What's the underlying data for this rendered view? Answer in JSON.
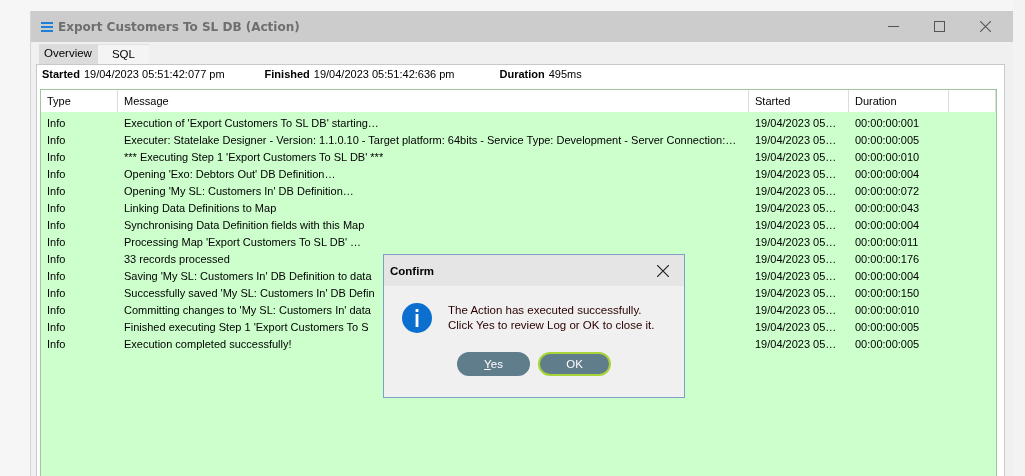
{
  "window": {
    "title": "Export Customers To SL DB (Action)"
  },
  "tabs": [
    {
      "label": "Overview",
      "selected": true
    },
    {
      "label": "SQL",
      "selected": false
    }
  ],
  "summary": [
    {
      "label": "Started",
      "value": "19/04/2023 05:51:42:077 pm"
    },
    {
      "label": "Finished",
      "value": "19/04/2023 05:51:42:636 pm"
    },
    {
      "label": "Duration",
      "value": "495ms"
    }
  ],
  "table": {
    "columns": [
      "Type",
      "Message",
      "Started",
      "Duration"
    ],
    "rows": [
      {
        "type": "Info",
        "message": "Execution of 'Export Customers To SL DB' starting…",
        "started": "19/04/2023 05…",
        "duration": "00:00:00:001"
      },
      {
        "type": "Info",
        "message": "Executer: Statelake Designer - Version: 1.1.0.10 - Target platform:  64bits - Service Type: Development - Server Connection:…",
        "started": "19/04/2023 05…",
        "duration": "00:00:00:005"
      },
      {
        "type": "Info",
        "message": "*** Executing Step 1 'Export Customers To SL DB' ***",
        "started": "19/04/2023 05…",
        "duration": "00:00:00:010"
      },
      {
        "type": "Info",
        "message": "Opening 'Exo: Debtors Out' DB Definition…",
        "started": "19/04/2023 05…",
        "duration": "00:00:00:004"
      },
      {
        "type": "Info",
        "message": "Opening 'My SL: Customers In' DB Definition…",
        "started": "19/04/2023 05…",
        "duration": "00:00:00:072"
      },
      {
        "type": "Info",
        "message": "Linking Data Definitions to Map",
        "started": "19/04/2023 05…",
        "duration": "00:00:00:043"
      },
      {
        "type": "Info",
        "message": "Synchronising Data Definition fields with this Map",
        "started": "19/04/2023 05…",
        "duration": "00:00:00:004"
      },
      {
        "type": "Info",
        "message": "Processing Map 'Export Customers To SL DB' …",
        "started": "19/04/2023 05…",
        "duration": "00:00:00:011"
      },
      {
        "type": "Info",
        "message": "33 records processed",
        "started": "19/04/2023 05…",
        "duration": "00:00:00:176"
      },
      {
        "type": "Info",
        "message": "Saving 'My SL: Customers In' DB Definition to data",
        "started": "19/04/2023 05…",
        "duration": "00:00:00:004"
      },
      {
        "type": "Info",
        "message": "Successfully saved 'My SL: Customers In' DB Defin",
        "started": "19/04/2023 05…",
        "duration": "00:00:00:150"
      },
      {
        "type": "Info",
        "message": "Committing changes to 'My SL: Customers In' data",
        "started": "19/04/2023 05…",
        "duration": "00:00:00:010"
      },
      {
        "type": "Info",
        "message": "Finished executing Step 1 'Export Customers To S",
        "started": "19/04/2023 05…",
        "duration": "00:00:00:005"
      },
      {
        "type": "Info",
        "message": "Execution completed successfully!",
        "started": "19/04/2023 05…",
        "duration": "00:00:00:005"
      }
    ]
  },
  "dialog": {
    "title": "Confirm",
    "message_lines": [
      "The Action has executed successfully.",
      "Click Yes to review Log or OK to close it."
    ],
    "buttons": [
      {
        "label": "Yes",
        "default": false
      },
      {
        "label": "OK",
        "default": true
      }
    ]
  }
}
